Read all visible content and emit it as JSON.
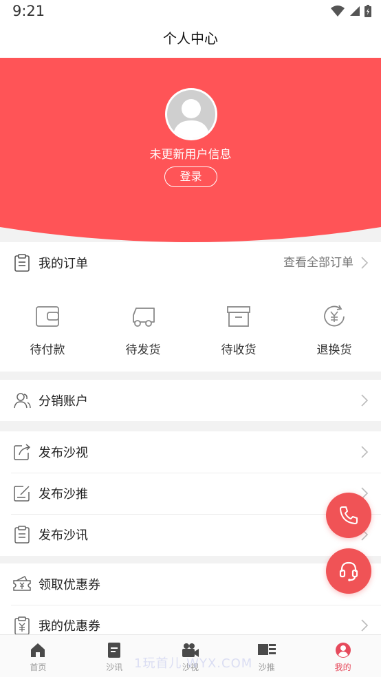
{
  "status_bar": {
    "time": "9:21"
  },
  "header": {
    "title": "个人中心"
  },
  "profile": {
    "user_info": "未更新用户信息",
    "login_label": "登录",
    "accent_color": "#ff5457"
  },
  "orders": {
    "title": "我的订单",
    "view_all": "查看全部订单",
    "statuses": [
      {
        "label": "待付款",
        "icon": "wallet-icon"
      },
      {
        "label": "待发货",
        "icon": "truck-icon"
      },
      {
        "label": "待收货",
        "icon": "box-icon"
      },
      {
        "label": "退换货",
        "icon": "yuan-exchange-icon"
      }
    ]
  },
  "menu": {
    "distribution": {
      "label": "分销账户",
      "icon": "users-icon"
    },
    "publish_video": {
      "label": "发布沙视",
      "icon": "share-edit-icon"
    },
    "publish_push": {
      "label": "发布沙推",
      "icon": "edit-square-icon"
    },
    "publish_news": {
      "label": "发布沙讯",
      "icon": "clipboard-icon"
    },
    "claim_coupon": {
      "label": "领取优惠券",
      "icon": "ticket-icon"
    },
    "my_coupons": {
      "label": "我的优惠券",
      "icon": "coupon-clipboard-icon"
    }
  },
  "fab": {
    "phone_icon": "phone-icon",
    "support_icon": "headset-icon",
    "color": "#f05356"
  },
  "tabs": [
    {
      "label": "首页",
      "icon": "home-icon"
    },
    {
      "label": "沙讯",
      "icon": "document-icon"
    },
    {
      "label": "沙视",
      "icon": "video-camera-icon"
    },
    {
      "label": "沙推",
      "icon": "news-icon"
    },
    {
      "label": "我的",
      "icon": "user-circle-icon",
      "active": true
    }
  ],
  "watermark": "1玩首儿 WYX.COM"
}
